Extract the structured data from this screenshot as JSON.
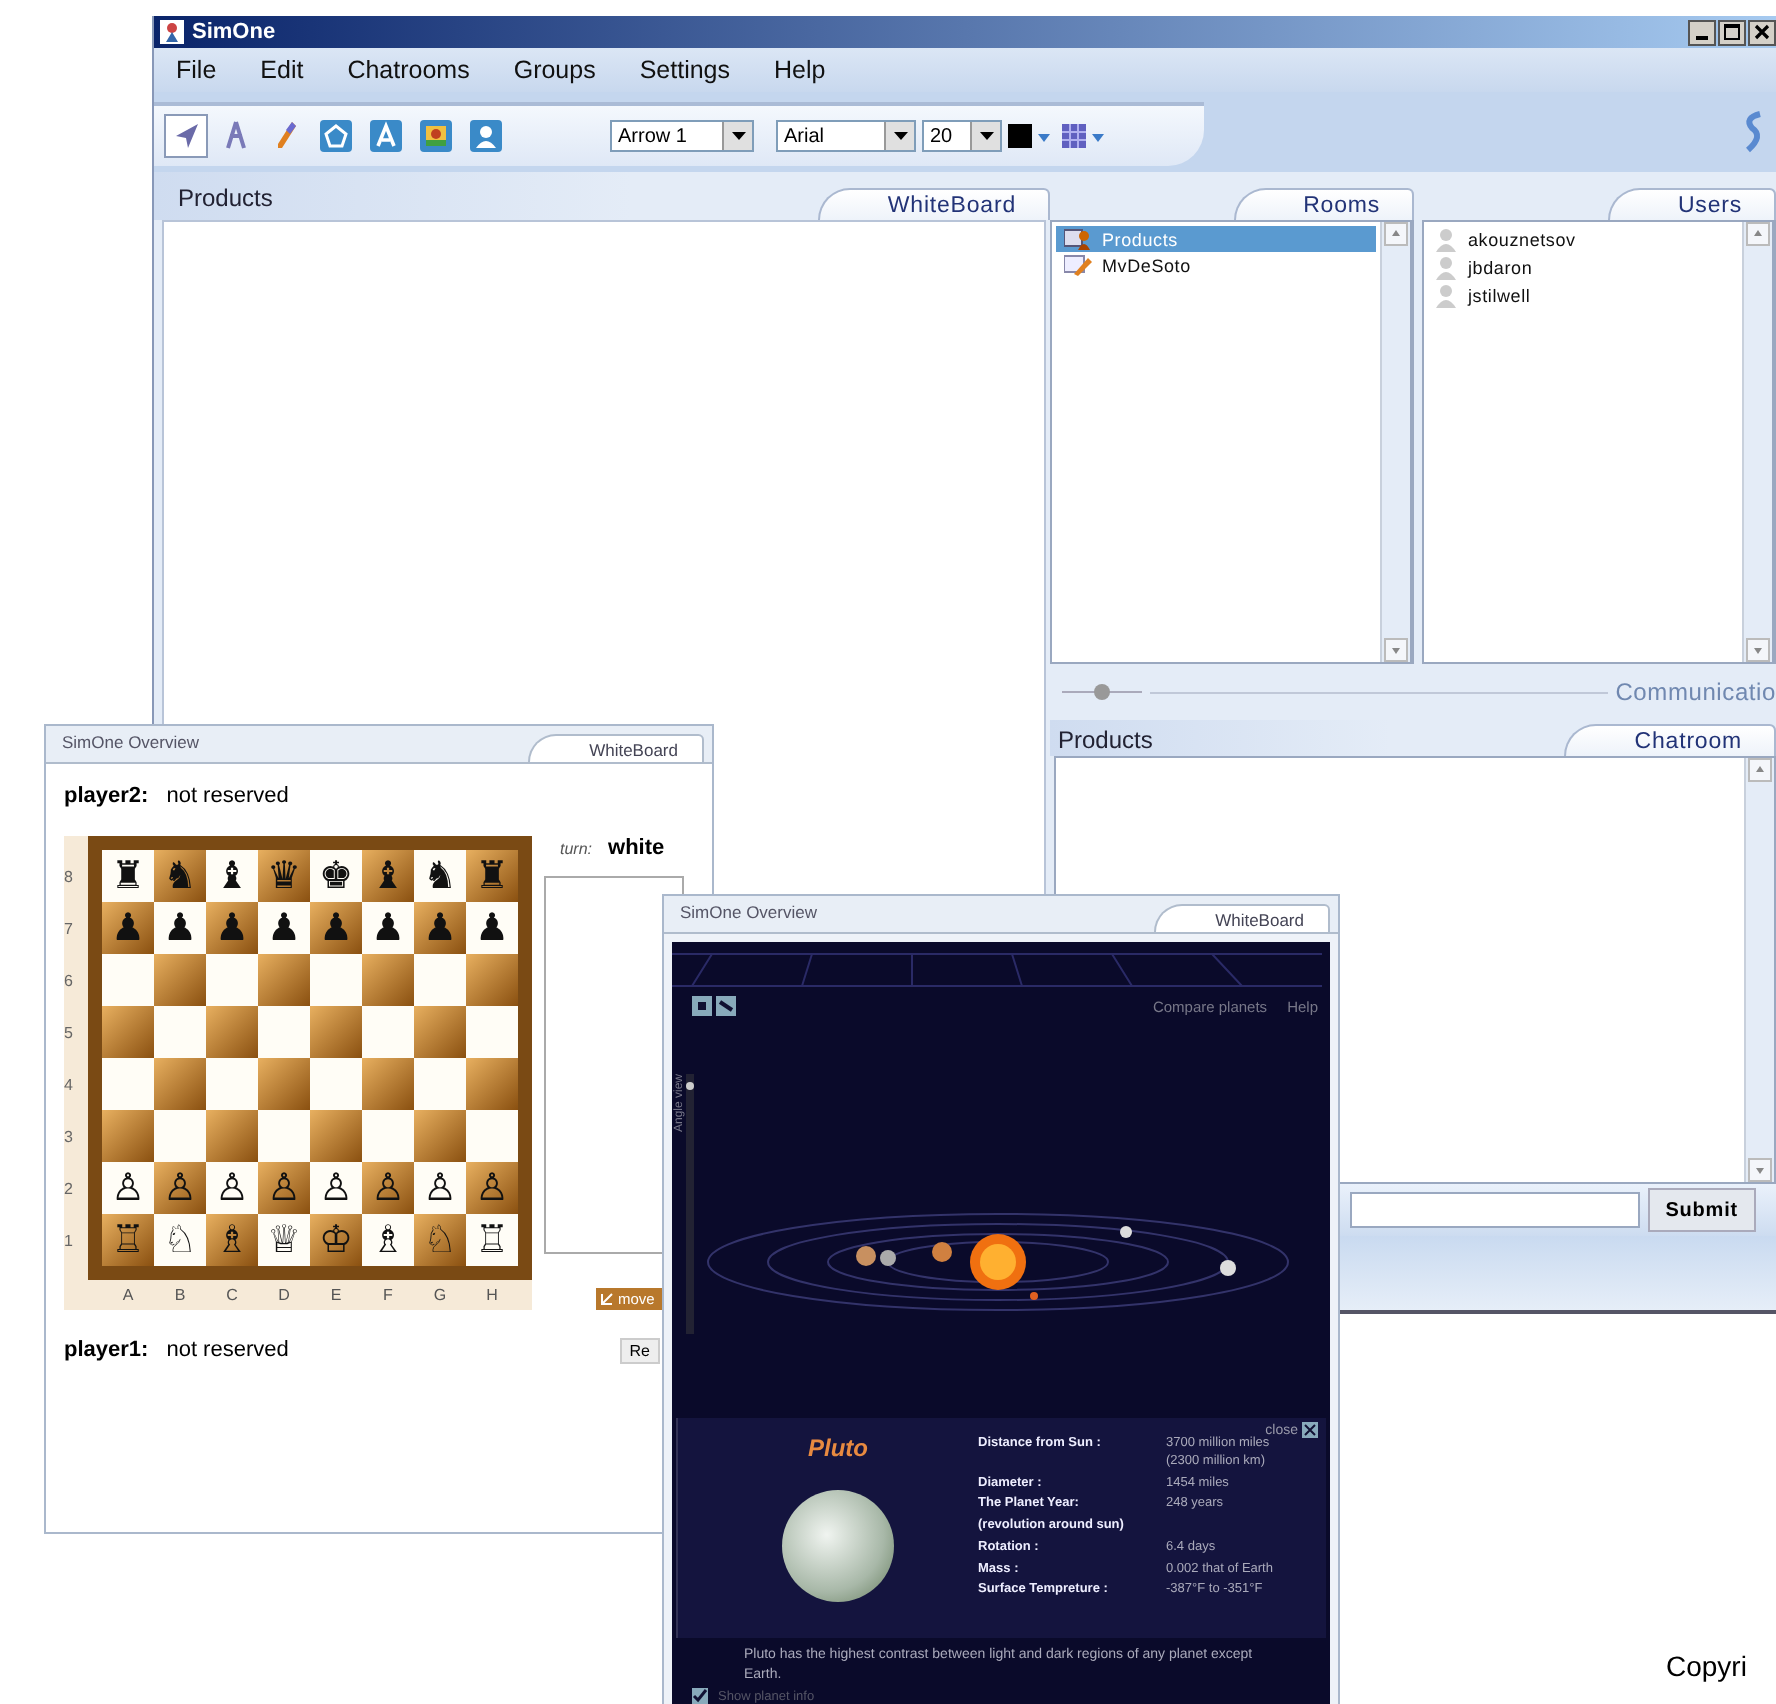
{
  "main_window": {
    "title": "SimOne",
    "menu": [
      "File",
      "Edit",
      "Chatrooms",
      "Groups",
      "Settings",
      "Help"
    ],
    "toolbar": {
      "tools": [
        {
          "kind": "arrow",
          "selected": true
        },
        {
          "kind": "pointer",
          "selected": false
        },
        {
          "kind": "pen",
          "selected": false
        },
        {
          "kind": "polygon",
          "selected": false
        },
        {
          "kind": "text",
          "selected": false
        },
        {
          "kind": "image",
          "selected": false
        },
        {
          "kind": "user",
          "selected": false
        }
      ],
      "shape_select": "Arrow 1",
      "font_select": "Arial",
      "size_select": "20"
    },
    "whiteboard": {
      "room_label": "Products",
      "tab": "WhiteBoard"
    },
    "rooms": {
      "tab": "Rooms",
      "items": [
        {
          "name": "Products",
          "kind": "room",
          "selected": true
        },
        {
          "name": "MvDeSoto",
          "kind": "whiteboard",
          "selected": false
        }
      ]
    },
    "users": {
      "tab": "Users",
      "items": [
        "akouznetsov",
        "jbdaron",
        "jstilwell"
      ]
    },
    "splitter_label": "Communicatio",
    "chatroom": {
      "room_label": "Products",
      "tab": "Chatroom",
      "submit": "Submit"
    }
  },
  "chess_window": {
    "title": "SimOne Overview",
    "tab": "WhiteBoard",
    "player2_label": "player2:",
    "player2_status": "not reserved",
    "ranks": [
      {
        "label": "8",
        "pieces": [
          "♜",
          "♞",
          "♝",
          "♛",
          "♚",
          "♝",
          "♞",
          "♜"
        ]
      },
      {
        "label": "7",
        "pieces": [
          "♟",
          "♟",
          "♟",
          "♟",
          "♟",
          "♟",
          "♟",
          "♟"
        ]
      },
      {
        "label": "6"
      },
      {
        "label": "5"
      },
      {
        "label": "4"
      },
      {
        "label": "3"
      },
      {
        "label": "2",
        "pieces": [
          "♙",
          "♙",
          "♙",
          "♙",
          "♙",
          "♙",
          "♙",
          "♙"
        ]
      },
      {
        "label": "1",
        "pieces": [
          "♖",
          "♘",
          "♗",
          "♕",
          "♔",
          "♗",
          "♘",
          "♖"
        ]
      }
    ],
    "files": [
      "A",
      "B",
      "C",
      "D",
      "E",
      "F",
      "G",
      "H"
    ],
    "turn_label": "turn:",
    "turn": "white",
    "move_button": "move",
    "player1_label": "player1:",
    "player1_status": "not reserved",
    "reserve_button": "Re"
  },
  "planet_window": {
    "title": "SimOne Overview",
    "tab": "WhiteBoard",
    "links": [
      "Compare planets",
      "Help"
    ],
    "angle_view": {
      "label": "Angle view",
      "level": 0.97
    },
    "close": "close",
    "planet": "Pluto",
    "facts": [
      {
        "label": "Distance from Sun :",
        "values": [
          "3700 million miles",
          "(2300 million km)"
        ]
      },
      {
        "label": "Diameter :",
        "values": [
          "1454 miles"
        ]
      },
      {
        "label": "The Planet Year:",
        "values": [
          "248 years"
        ]
      },
      {
        "label": "(revolution around sun)"
      },
      {
        "label": "Rotation :",
        "values": [
          "6.4 days"
        ]
      },
      {
        "label": "Mass :",
        "values": [
          "0.002 that of Earth"
        ]
      },
      {
        "label": "Surface Tempreture :",
        "values": [
          "-387°F to -351°F"
        ]
      }
    ],
    "description": "Pluto has the highest contrast between light and dark regions of any planet except Earth.",
    "show_info": {
      "label": "Show planet info",
      "checked": true
    }
  },
  "footer": "Copyri"
}
